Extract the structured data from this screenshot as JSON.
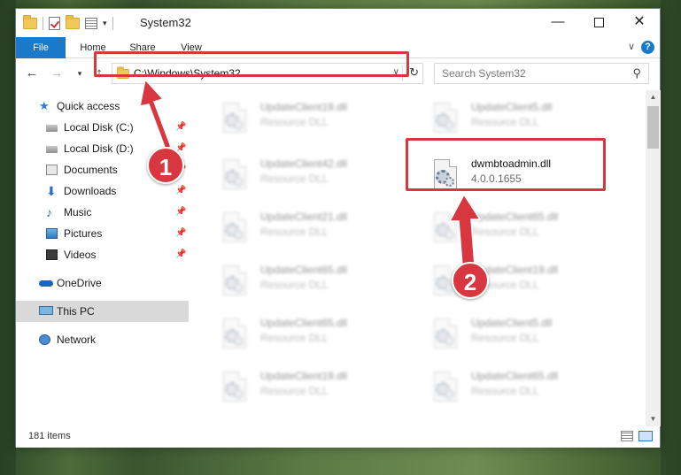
{
  "window": {
    "title": "System32",
    "minimize_glyph": "—",
    "close_glyph": "✕"
  },
  "ribbon": {
    "tabs": [
      {
        "label": "File"
      },
      {
        "label": "Home"
      },
      {
        "label": "Share"
      },
      {
        "label": "View"
      }
    ],
    "help_glyph": "?"
  },
  "address": {
    "path": "C:\\Windows\\System32"
  },
  "search": {
    "placeholder": "Search System32"
  },
  "nav_pane": {
    "items": [
      {
        "label": "Quick access",
        "icon": "star-icon"
      },
      {
        "label": "Local Disk (C:)",
        "icon": "drive-icon",
        "pinned": true
      },
      {
        "label": "Local Disk (D:)",
        "icon": "drive-icon",
        "pinned": true
      },
      {
        "label": "Documents",
        "icon": "documents-icon",
        "pinned": true
      },
      {
        "label": "Downloads",
        "icon": "download-icon",
        "pinned": true
      },
      {
        "label": "Music",
        "icon": "music-icon",
        "pinned": true
      },
      {
        "label": "Pictures",
        "icon": "pictures-icon",
        "pinned": true
      },
      {
        "label": "Videos",
        "icon": "videos-icon",
        "pinned": true
      },
      {
        "label": "OneDrive",
        "icon": "cloud-icon"
      },
      {
        "label": "This PC",
        "icon": "computer-icon",
        "selected": true
      },
      {
        "label": "Network",
        "icon": "network-icon"
      }
    ]
  },
  "files": [
    {
      "name": "UpdateClient19.dll",
      "desc": "Resource DLL",
      "blurred": true
    },
    {
      "name": "UpdateClient5.dll",
      "desc": "Resource DLL",
      "blurred": true
    },
    {
      "name": "UpdateClient42.dll",
      "desc": "Resource DLL",
      "blurred": true
    },
    {
      "name": "dwmbtoadmin.dll",
      "desc": "4.0.0.1655",
      "blurred": false
    },
    {
      "name": "UpdateClient21.dll",
      "desc": "Resource DLL",
      "blurred": true
    },
    {
      "name": "UpdateClient65.dll",
      "desc": "Resource DLL",
      "blurred": true
    },
    {
      "name": "UpdateClient65.dll",
      "desc": "Resource DLL",
      "blurred": true
    },
    {
      "name": "UpdateClient19.dll",
      "desc": "Resource DLL",
      "blurred": true
    },
    {
      "name": "UpdateClient65.dll",
      "desc": "Resource DLL",
      "blurred": true
    },
    {
      "name": "UpdateClient5.dll",
      "desc": "Resource DLL",
      "blurred": true
    },
    {
      "name": "UpdateClient19.dll",
      "desc": "Resource DLL",
      "blurred": true
    },
    {
      "name": "UpdateClient65.dll",
      "desc": "Resource DLL",
      "blurred": true
    }
  ],
  "status": {
    "item_count": "181 items"
  },
  "annotations": {
    "step1": "1",
    "step2": "2",
    "color": "#d9373f"
  }
}
